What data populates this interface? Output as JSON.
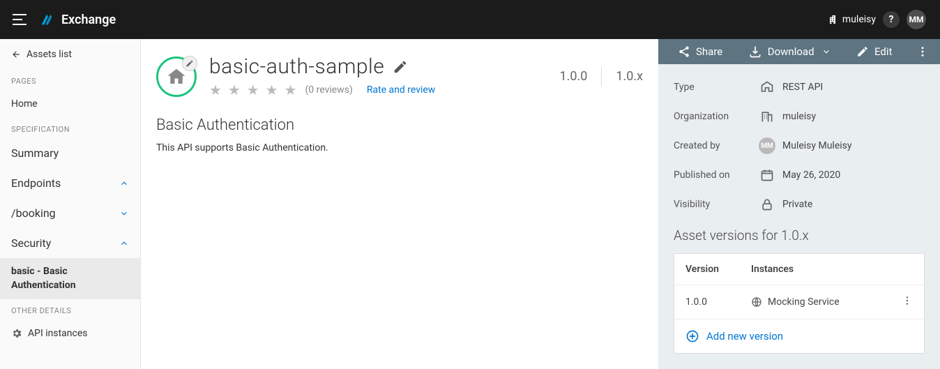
{
  "topbar": {
    "app_name": "Exchange",
    "business_label": "muleisy",
    "help_glyph": "?",
    "avatar_initials": "MM"
  },
  "sidebar": {
    "back_label": "Assets list",
    "pages_label": "PAGES",
    "home_label": "Home",
    "spec_label": "SPECIFICATION",
    "summary_label": "Summary",
    "endpoints_label": "Endpoints",
    "booking_label": "/booking",
    "security_label": "Security",
    "selected_label": "basic - Basic Authentication",
    "other_label": "OTHER DETAILS",
    "api_instances_label": "API instances"
  },
  "main": {
    "title": "basic-auth-sample",
    "stars": "★ ★ ★ ★ ★",
    "reviews": "(0 reviews)",
    "rate_link": "Rate and review",
    "version": "1.0.0",
    "version_branch": "1.0.x",
    "heading": "Basic Authentication",
    "body": "This API supports Basic Authentication."
  },
  "actions": {
    "share": "Share",
    "download": "Download",
    "edit": "Edit"
  },
  "meta": {
    "type_label": "Type",
    "type_value": "REST API",
    "org_label": "Organization",
    "org_value": "muleisy",
    "created_label": "Created by",
    "created_value": "Muleisy Muleisy",
    "created_initials": "MM",
    "published_label": "Published on",
    "published_value": "May 26, 2020",
    "visibility_label": "Visibility",
    "visibility_value": "Private",
    "versions_heading": "Asset versions for 1.0.x",
    "col_version": "Version",
    "col_instances": "Instances",
    "row_version": "1.0.0",
    "row_instance": "Mocking Service",
    "add_version": "Add new version"
  }
}
